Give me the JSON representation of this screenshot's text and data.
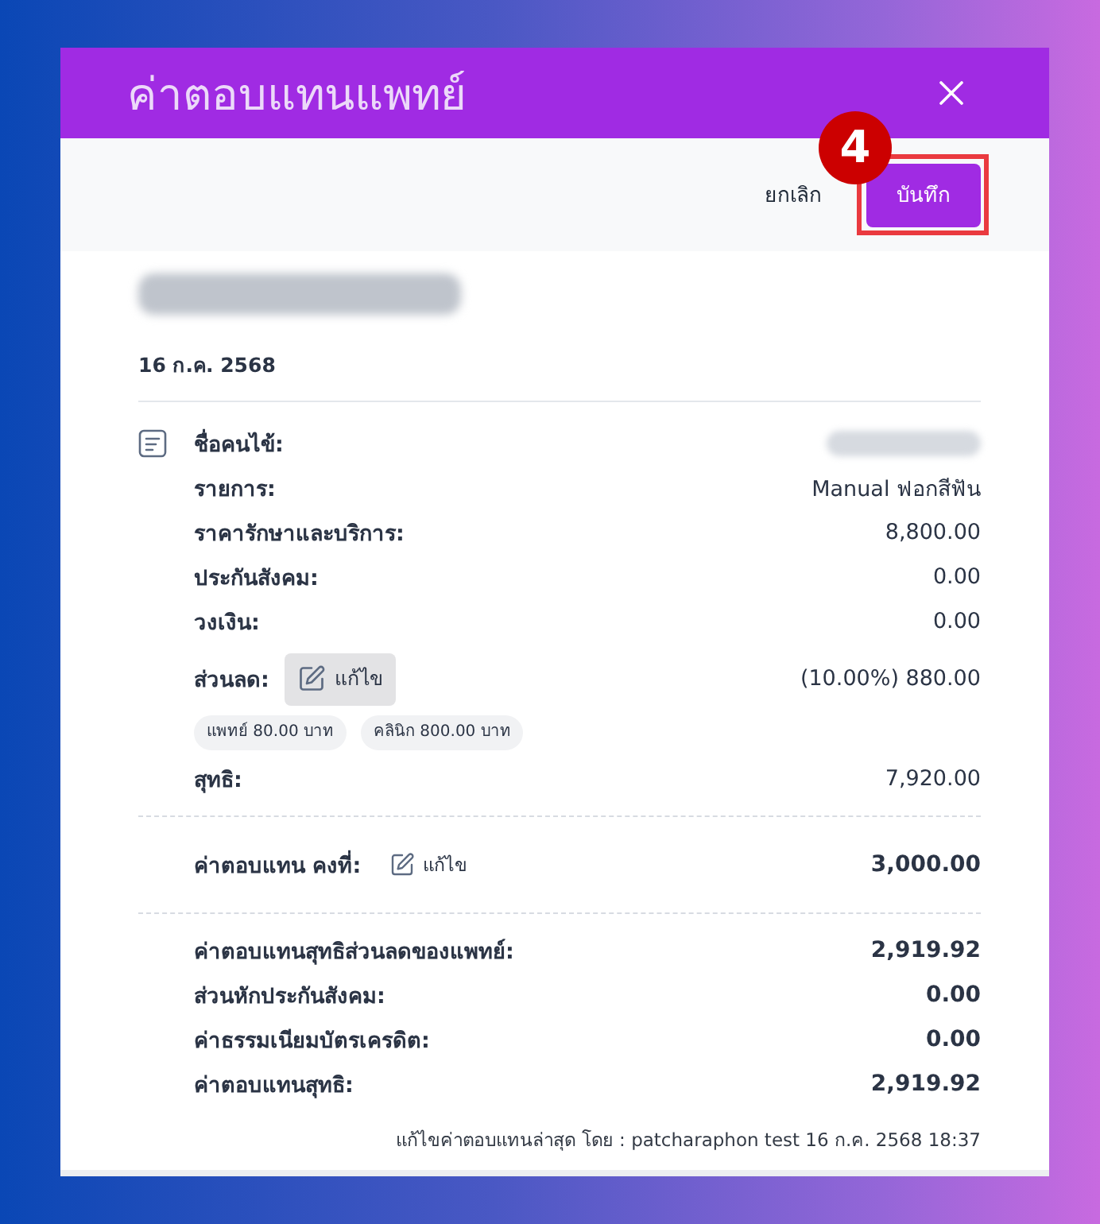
{
  "dialog": {
    "title": "ค่าตอบแทนแพทย์"
  },
  "actions": {
    "cancel": "ยกเลิก",
    "save": {
      "label": "บันทึก",
      "highlighted": true
    },
    "step_badge": "4"
  },
  "heading": {
    "name_redacted": true,
    "date": "16 ก.ค. 2568"
  },
  "details": [
    {
      "kind": "redacted",
      "label": "ชื่อคนไข้:"
    },
    {
      "kind": "text",
      "label": "รายการ:",
      "value": "Manual ฟอกสีฟัน"
    },
    {
      "kind": "text",
      "label": "ราคารักษาและบริการ:",
      "value": "8,800.00"
    },
    {
      "kind": "text",
      "label": "ประกันสังคม:",
      "value": "0.00"
    },
    {
      "kind": "text",
      "label": "วงเงิน:",
      "value": "0.00"
    },
    {
      "kind": "editable",
      "label": "ส่วนลด:",
      "edit": {
        "label": "แก้ไข",
        "hovered": true
      },
      "value": "(10.00%) 880.00",
      "chips": [
        "แพทย์ 80.00 บาท",
        "คลินิก 800.00 บาท"
      ]
    },
    {
      "kind": "text",
      "label": "สุทธิ:",
      "value": "7,920.00"
    }
  ],
  "fixed_fee": {
    "label": "ค่าตอบแทน คงที่:",
    "edit": {
      "label": "แก้ไข",
      "hovered": false
    },
    "value": "3,000.00"
  },
  "summary": [
    {
      "label": "ค่าตอบแทนสุทธิส่วนลดของแพทย์:",
      "value": "2,919.92"
    },
    {
      "label": "ส่วนหักประกันสังคม:",
      "value": "0.00"
    },
    {
      "label": "ค่าธรรมเนียมบัตรเครดิต:",
      "value": "0.00"
    },
    {
      "label": "ค่าตอบแทนสุทธิ:",
      "value": "2,919.92"
    }
  ],
  "footer": "แก้ไขค่าตอบแทนล่าสุด โดย : patcharaphon test 16 ก.ค. 2568 18:37"
}
